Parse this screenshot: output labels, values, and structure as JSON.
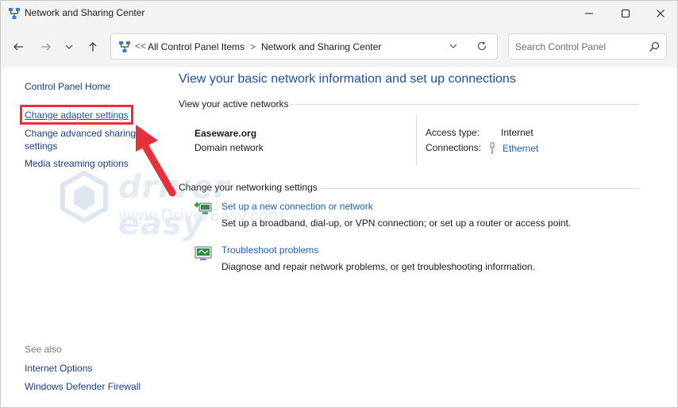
{
  "window": {
    "title": "Network and Sharing Center"
  },
  "nav": {
    "breadcrumb_prefix": "<<",
    "breadcrumb_1": "All Control Panel Items",
    "breadcrumb_sep": ">",
    "breadcrumb_2": "Network and Sharing Center",
    "search_placeholder": "Search Control Panel"
  },
  "sidebar": {
    "home": "Control Panel Home",
    "adapter": "Change adapter settings",
    "advanced": "Change advanced sharing settings",
    "media": "Media streaming options",
    "see_also": "See also",
    "internet_options": "Internet Options",
    "firewall": "Windows Defender Firewall"
  },
  "main": {
    "title": "View your basic network information and set up connections",
    "active_networks_heading": "View your active networks",
    "network_name": "Easeware.org",
    "network_type": "Domain network",
    "access_type_label": "Access type:",
    "access_type_value": "Internet",
    "connections_label": "Connections:",
    "connections_value": "Ethernet",
    "settings_heading": "Change your networking settings",
    "setup_link": "Set up a new connection or network",
    "setup_desc": "Set up a broadband, dial-up, or VPN connection; or set up a router or access point.",
    "trouble_link": "Troubleshoot problems",
    "trouble_desc": "Diagnose and repair network problems, or get troubleshooting information."
  },
  "watermark": {
    "brand": "driver easy",
    "url": "www.DriverEasy.com"
  },
  "colors": {
    "link": "#1e5fb8",
    "title": "#1e4fa0",
    "highlight": "#e8303a"
  }
}
